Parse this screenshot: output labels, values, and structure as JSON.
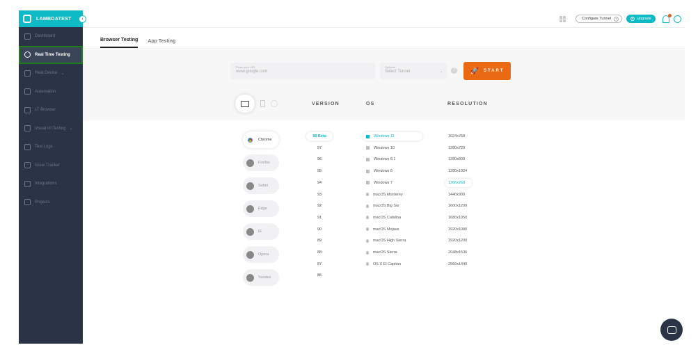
{
  "brand": {
    "name": "LAMBDATEST",
    "toggle": "‹"
  },
  "sidebar": {
    "items": [
      {
        "label": "Dashboard",
        "icon": "dashboard-icon",
        "active": false
      },
      {
        "label": "Real Time Testing",
        "icon": "clock-icon",
        "active": true
      },
      {
        "label": "Real Device",
        "icon": "device-icon",
        "active": false,
        "chevron": "⌄"
      },
      {
        "label": "Automation",
        "icon": "robot-icon",
        "active": false
      },
      {
        "label": "LT Browser",
        "icon": "browser-icon",
        "active": false
      },
      {
        "label": "Visual UI Testing",
        "icon": "visual-icon",
        "active": false,
        "chevron": "⌄"
      },
      {
        "label": "Test Logs",
        "icon": "logs-icon",
        "active": false
      },
      {
        "label": "Issue Tracker",
        "icon": "bug-icon",
        "active": false
      },
      {
        "label": "Integrations",
        "icon": "integrations-icon",
        "active": false
      },
      {
        "label": "Projects",
        "icon": "folder-icon",
        "active": false
      }
    ]
  },
  "topbar": {
    "configure_tunnel": "Configure Tunnel",
    "help": "?",
    "upgrade": "Upgrade",
    "upgrade_icon": "+"
  },
  "tabs": [
    {
      "label": "Browser Testing",
      "active": true
    },
    {
      "label": "App Testing",
      "active": false
    }
  ],
  "url": {
    "label": "Place your URL",
    "placeholder": "www.google.com"
  },
  "tunnel": {
    "label": "Optional",
    "placeholder": "Select Tunnel",
    "caret": "⌄"
  },
  "help_icon": "?",
  "start": {
    "label": "START",
    "icon": "rocket-icon"
  },
  "columns": {
    "version": "VERSION",
    "os": "OS",
    "resolution": "RESOLUTION"
  },
  "browsers": [
    {
      "name": "Chrome",
      "active": true
    },
    {
      "name": "Firefox",
      "active": false
    },
    {
      "name": "Safari",
      "active": false
    },
    {
      "name": "Edge",
      "active": false
    },
    {
      "name": "IE",
      "active": false
    },
    {
      "name": "Opera",
      "active": false
    },
    {
      "name": "Yandex",
      "active": false
    }
  ],
  "versions": [
    {
      "v": "98 Beta",
      "active": true
    },
    {
      "v": "97"
    },
    {
      "v": "96"
    },
    {
      "v": "95"
    },
    {
      "v": "94"
    },
    {
      "v": "93"
    },
    {
      "v": "92"
    },
    {
      "v": "91"
    },
    {
      "v": "90"
    },
    {
      "v": "89"
    },
    {
      "v": "88"
    },
    {
      "v": "87"
    },
    {
      "v": "86"
    }
  ],
  "os_list": [
    {
      "name": "Windows 11",
      "kind": "windows",
      "active": true
    },
    {
      "name": "Windows 10",
      "kind": "windows"
    },
    {
      "name": "Windows 8.1",
      "kind": "windows"
    },
    {
      "name": "Windows 8",
      "kind": "windows"
    },
    {
      "name": "Windows 7",
      "kind": "windows"
    },
    {
      "name": "macOS Monterey",
      "kind": "apple"
    },
    {
      "name": "macOS Big Sur",
      "kind": "apple"
    },
    {
      "name": "macOS Catalina",
      "kind": "apple"
    },
    {
      "name": "macOS Mojave",
      "kind": "apple"
    },
    {
      "name": "macOS High Sierra",
      "kind": "apple"
    },
    {
      "name": "macOS Sierra",
      "kind": "apple"
    },
    {
      "name": "OS X El Capitan",
      "kind": "apple"
    }
  ],
  "resolutions": [
    {
      "r": "1024x768"
    },
    {
      "r": "1280x720"
    },
    {
      "r": "1280x800"
    },
    {
      "r": "1280x1024"
    },
    {
      "r": "1366x768",
      "active": true
    },
    {
      "r": "1440x900"
    },
    {
      "r": "1600x1200"
    },
    {
      "r": "1680x1050"
    },
    {
      "r": "1920x1080"
    },
    {
      "r": "1920x1200"
    },
    {
      "r": "2048x1536"
    },
    {
      "r": "2560x1440"
    }
  ],
  "colors": {
    "brand": "#0ebac5",
    "sidebar": "#2b3446",
    "start": "#ea6a14",
    "active_border": "#1e7e1a"
  }
}
